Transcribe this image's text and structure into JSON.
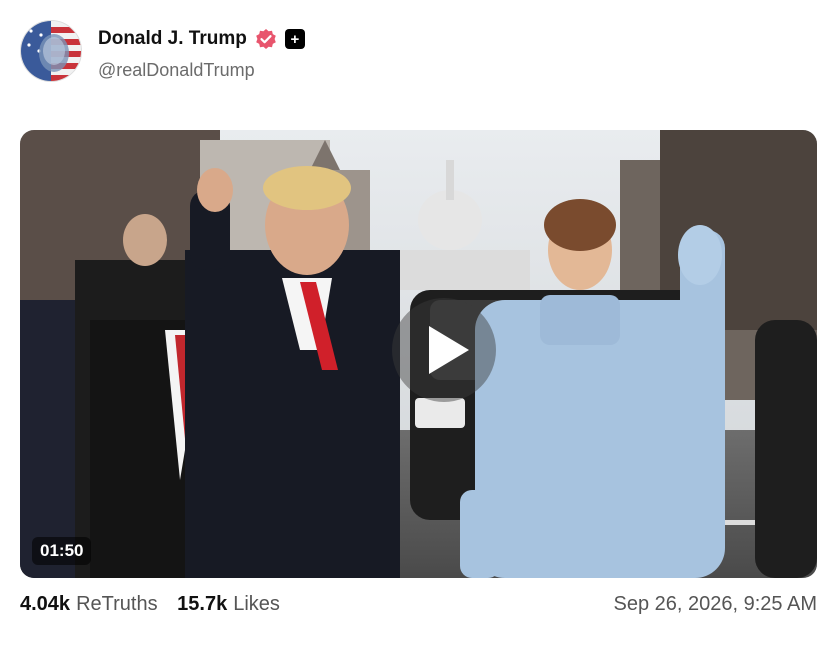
{
  "post": {
    "author": {
      "display_name": "Donald J. Trump",
      "handle": "@realDonaldTrump",
      "avatar_icon": "flag-portrait-avatar",
      "verified_icon": "verified-badge-icon",
      "plus_badge": "+"
    },
    "media": {
      "type": "video",
      "duration": "01:50",
      "play_icon": "play-icon"
    },
    "stats": {
      "retruths_count": "4.04k",
      "retruths_label": "ReTruths",
      "likes_count": "15.7k",
      "likes_label": "Likes"
    },
    "timestamp": "Sep 26, 2026, 9:25 AM"
  },
  "colors": {
    "verified": "#e8556d",
    "text_primary": "#111111",
    "text_secondary": "#6b6b6b"
  }
}
